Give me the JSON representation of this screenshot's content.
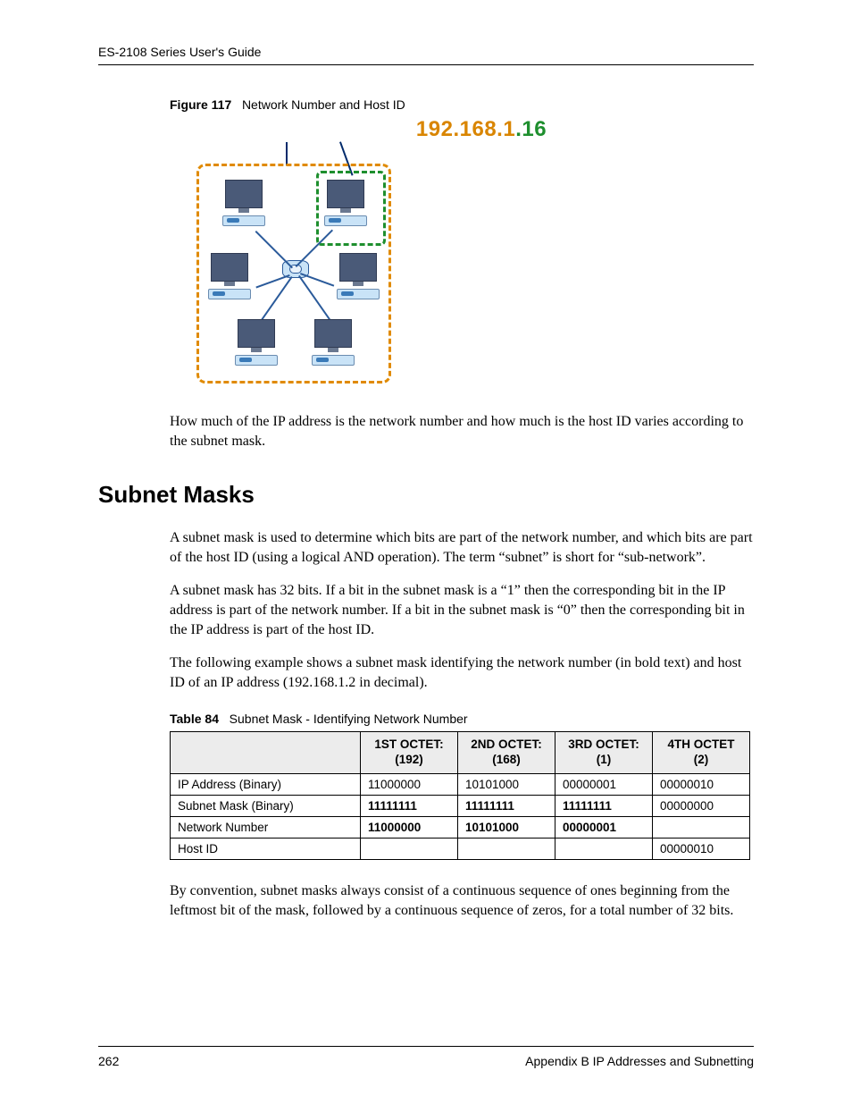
{
  "header": {
    "guide": "ES-2108 Series User's Guide"
  },
  "figure": {
    "label": "Figure 117",
    "title": "Network Number and Host ID",
    "ip_network": "192.168.1",
    "ip_dot": ".",
    "ip_host": "16"
  },
  "para1": "How much of the IP address is the network number and how much is the host ID varies according to the subnet mask.",
  "section_title": "Subnet Masks",
  "para2": "A subnet mask is used to determine which bits are part of the network number, and which bits are part of the host ID (using a logical AND operation). The term “subnet” is short for “sub-network”.",
  "para3": "A subnet mask has 32 bits. If a bit in the subnet mask is a “1” then the corresponding bit in the IP address is part of the network number. If a bit in the subnet mask is “0” then the corresponding bit in the IP address is part of the host ID.",
  "para4": "The following example shows a subnet mask identifying the network number (in bold text) and host ID of an IP address (192.168.1.2 in decimal).",
  "table": {
    "label": "Table 84",
    "title": "Subnet Mask - Identifying Network Number",
    "headers": [
      "",
      "1ST OCTET: (192)",
      "2ND OCTET: (168)",
      "3RD OCTET: (1)",
      "4TH OCTET (2)"
    ],
    "rows": [
      {
        "label": "IP Address (Binary)",
        "cells": [
          "11000000",
          "10101000",
          "00000001",
          "00000010"
        ],
        "bold": [
          false,
          false,
          false,
          false
        ]
      },
      {
        "label": "Subnet Mask (Binary)",
        "cells": [
          "11111111",
          "11111111",
          "11111111",
          "00000000"
        ],
        "bold": [
          true,
          true,
          true,
          false
        ]
      },
      {
        "label": "Network Number",
        "cells": [
          "11000000",
          "10101000",
          "00000001",
          ""
        ],
        "bold": [
          true,
          true,
          true,
          false
        ]
      },
      {
        "label": "Host ID",
        "cells": [
          "",
          "",
          "",
          "00000010"
        ],
        "bold": [
          false,
          false,
          false,
          false
        ]
      }
    ]
  },
  "para5": "By convention, subnet masks always consist of a continuous sequence of ones beginning from the leftmost bit of the mask, followed by a continuous sequence of zeros, for a total number of 32 bits.",
  "footer": {
    "page": "262",
    "section": "Appendix B IP Addresses and Subnetting"
  }
}
